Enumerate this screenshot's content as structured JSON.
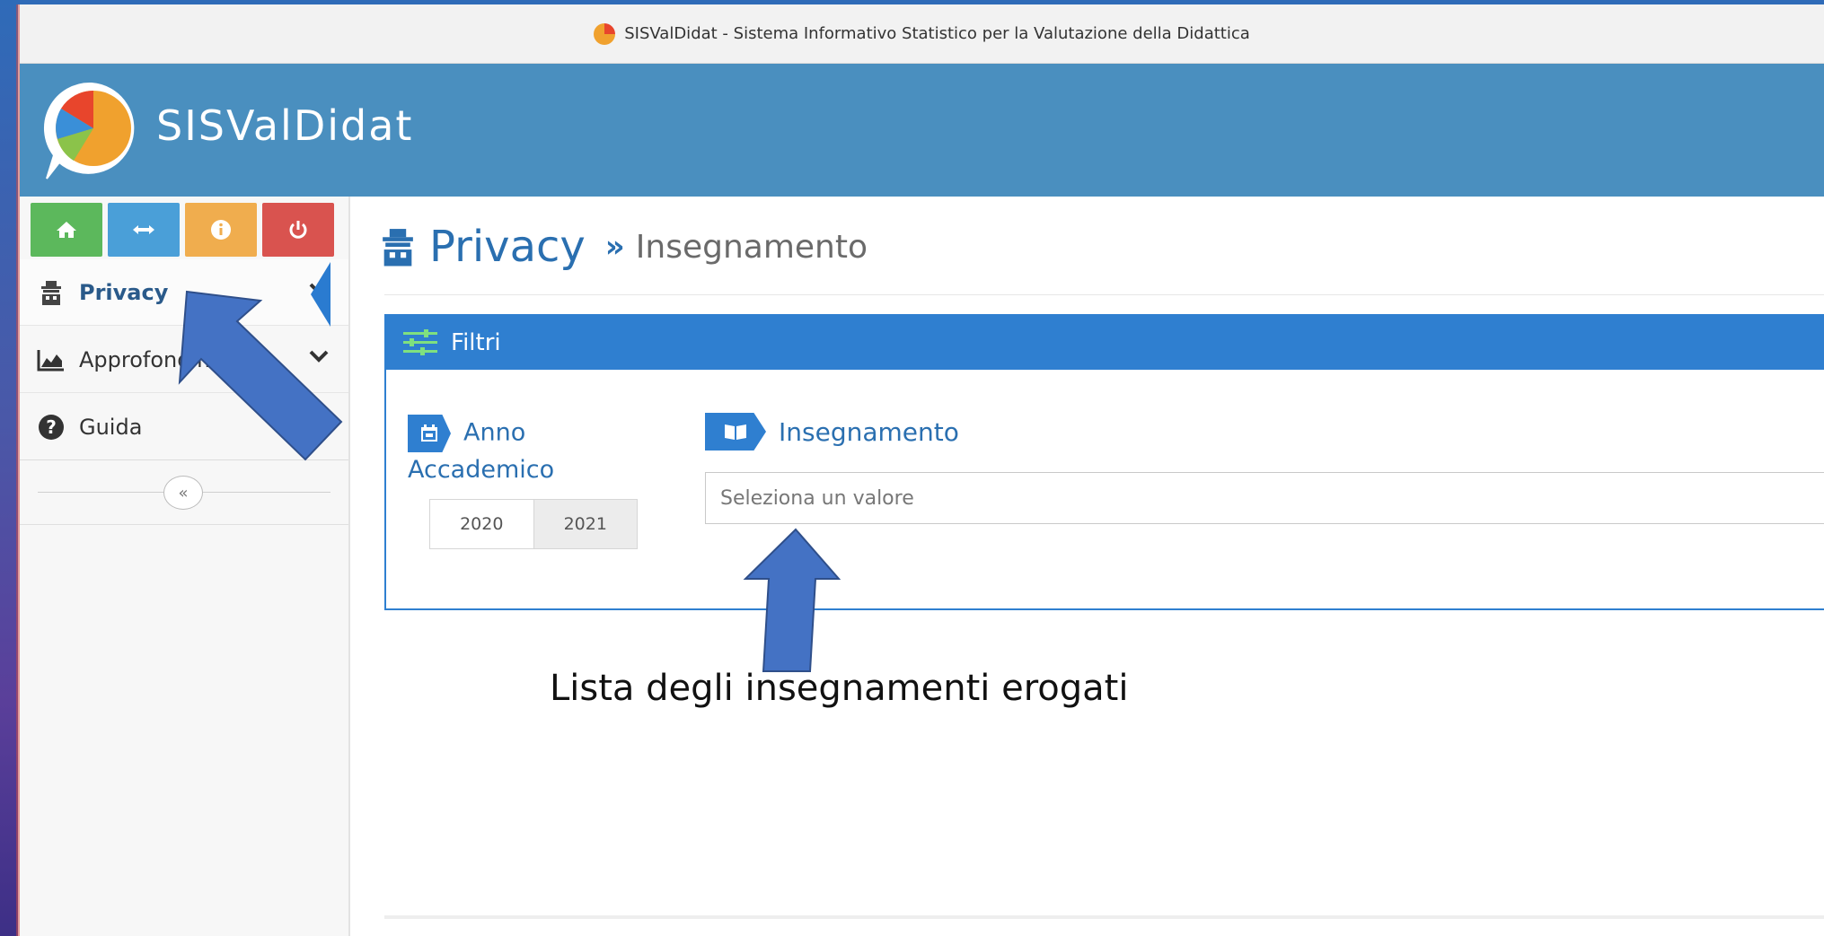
{
  "browser": {
    "title": "SISValDidat - Sistema Informativo Statistico per la Valutazione della Didattica"
  },
  "app": {
    "logo_text": "SISValDidat"
  },
  "quick_buttons": [
    {
      "name": "home",
      "icon": "home-icon"
    },
    {
      "name": "toggle",
      "icon": "swap-arrows-icon"
    },
    {
      "name": "info",
      "icon": "info-icon"
    },
    {
      "name": "logout",
      "icon": "power-icon"
    }
  ],
  "sidebar": {
    "items": [
      {
        "label": "Privacy",
        "icon": "privacy-spy-icon",
        "active": true
      },
      {
        "label": "Approfondim",
        "icon": "area-chart-icon"
      },
      {
        "label": "Guida",
        "icon": "question-circle-icon"
      }
    ],
    "collapse_label": "«"
  },
  "page": {
    "title": "Privacy",
    "breadcrumb_sep": "»",
    "breadcrumb_current": "Insegnamento"
  },
  "filters": {
    "header": "Filtri",
    "anno_label_line1": "Anno",
    "anno_label_line2": "Accademico",
    "years": [
      "2020",
      "2021"
    ],
    "selected_year": "2021",
    "insegnamento_label": "Insegnamento",
    "select_placeholder": "Seleziona un valore"
  },
  "annotation": {
    "caption": "Lista degli insegnamenti erogati"
  },
  "colors": {
    "header_bg": "#4a8fbf",
    "accent_blue": "#2f7fd0",
    "arrow_fill": "#4472c4",
    "home_green": "#5cb85c",
    "info_orange": "#f0ad4e",
    "power_red": "#d9534f"
  }
}
